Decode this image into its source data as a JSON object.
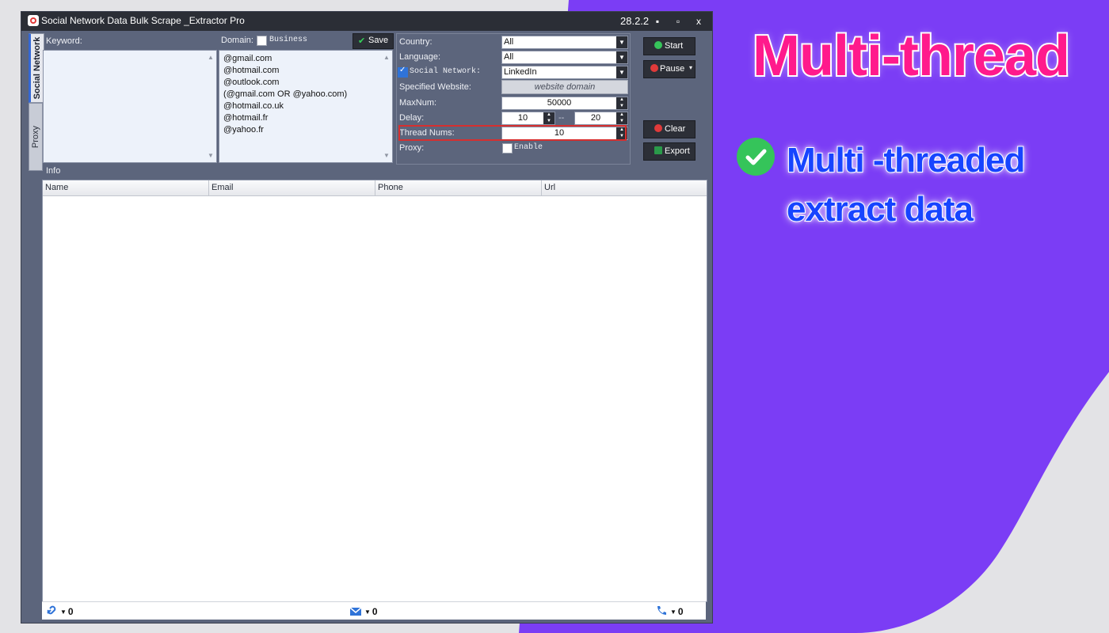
{
  "promo": {
    "headline": "Multi-thread",
    "feature_line1": "Multi -threaded",
    "feature_line2": "extract data",
    "colors": {
      "background_purple": "#7b3df5",
      "headline_pink": "#ff1a8c",
      "feature_blue": "#1744ff",
      "check_green": "#35c45a"
    }
  },
  "window": {
    "title": "Social Network Data Bulk Scrape _Extractor Pro",
    "version": "28.2.2",
    "controls": {
      "minimize": "▪",
      "maximize": "▫",
      "close": "x"
    },
    "tabs": [
      {
        "label": "Social Network",
        "active": true
      },
      {
        "label": "Proxy",
        "active": false
      }
    ]
  },
  "keyword": {
    "label": "Keyword:",
    "value": ""
  },
  "domain": {
    "label": "Domain:",
    "business_label": "Business",
    "business_checked": false,
    "save_label": "Save",
    "items": [
      "@gmail.com",
      "@hotmail.com",
      "@outlook.com",
      "(@gmail.com OR @yahoo.com)",
      "@hotmail.co.uk",
      "@hotmail.fr",
      "@yahoo.fr"
    ]
  },
  "settings": {
    "country_label": "Country:",
    "country_value": "All",
    "language_label": "Language:",
    "language_value": "All",
    "social_network_label": "Social Network:",
    "social_network_checked": true,
    "social_network_value": "LinkedIn",
    "website_label": "Specified Website:",
    "website_placeholder": "website domain",
    "maxnum_label": "MaxNum:",
    "maxnum_value": "50000",
    "delay_label": "Delay:",
    "delay_min": "10",
    "delay_sep": "--",
    "delay_max": "20",
    "thread_label": "Thread Nums:",
    "thread_value": "10",
    "proxy_label": "Proxy:",
    "proxy_enable_label": "Enable",
    "proxy_enabled": false
  },
  "actions": {
    "start": "Start",
    "pause": "Pause",
    "clear": "Clear",
    "export": "Export"
  },
  "info": {
    "label": "Info",
    "columns": [
      "Name",
      "Email",
      "Phone",
      "Url"
    ]
  },
  "status": {
    "links_count": "0",
    "emails_count": "0",
    "phones_count": "0"
  }
}
